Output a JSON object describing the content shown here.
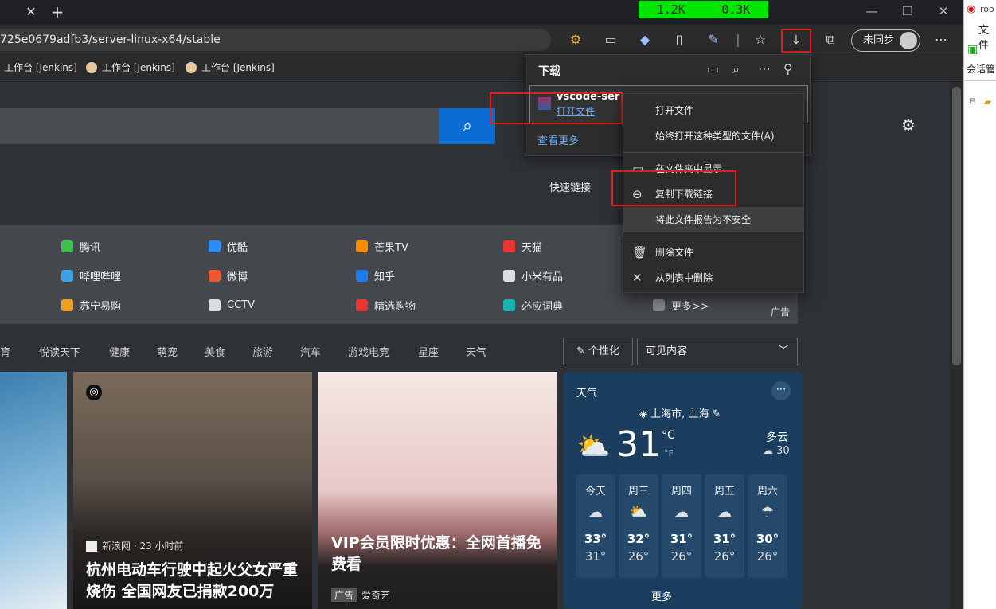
{
  "browser": {
    "tab_close": "✕",
    "tab_new": "+",
    "net_down": "1.2K",
    "net_up": "0.3K",
    "url": "725e0679adfb3/server-linux-x64/stable",
    "sync_label": "未同步"
  },
  "favorites": [
    {
      "label": "工作台 [Jenkins]"
    },
    {
      "label": "工作台 [Jenkins]"
    },
    {
      "label": "工作台 [Jenkins]"
    }
  ],
  "downloads": {
    "title": "下载",
    "file_name": "vscode-server-li",
    "open_file": "打开文件",
    "see_more": "查看更多"
  },
  "context_menu": {
    "items": [
      {
        "label": "打开文件"
      },
      {
        "label": "始终打开这种类型的文件(A)"
      },
      {
        "label": "在文件夹中显示"
      },
      {
        "label": "复制下载链接"
      },
      {
        "label": "将此文件报告为不安全"
      },
      {
        "label": "删除文件"
      },
      {
        "label": "从列表中删除"
      }
    ]
  },
  "newtab": {
    "quick_links": "快速链接",
    "links": [
      {
        "label": "腾讯",
        "color": "#3fbf4f"
      },
      {
        "label": "优酷",
        "color": "#2b8cff"
      },
      {
        "label": "芒果TV",
        "color": "#ff8a00"
      },
      {
        "label": "天猫",
        "color": "#e33"
      },
      {
        "label": "哔哩哔哩",
        "color": "#3aa0e8"
      },
      {
        "label": "微博",
        "color": "#e53"
      },
      {
        "label": "知乎",
        "color": "#1a7cf0"
      },
      {
        "label": "小米有品",
        "color": "#ddd"
      },
      {
        "label": "苏宁易购",
        "color": "#f0a020"
      },
      {
        "label": "CCTV",
        "color": "#ddd"
      },
      {
        "label": "精选购物",
        "color": "#e33"
      },
      {
        "label": "必应词典",
        "color": "#19b3b3"
      },
      {
        "label": "更多>>",
        "color": "#888"
      }
    ],
    "ad_label": "广告",
    "categories": [
      "体育",
      "悦读天下",
      "健康",
      "萌宠",
      "美食",
      "旅游",
      "汽车",
      "游戏电竞",
      "星座",
      "天气"
    ],
    "personalize": "个性化",
    "visible_content": "可见内容"
  },
  "cards": [
    {
      "source": "新浪网 · 23 小时前",
      "title": "杭州电动车行驶中起火父女严重烧伤 全国网友已捐款200万"
    },
    {
      "title": "VIP会员限时优惠：全网首播免费看",
      "ad": "广告",
      "source": "爱奇艺"
    }
  ],
  "weather": {
    "title": "天气",
    "location": "上海市, 上海",
    "temp": "31",
    "unit_c": "°C",
    "unit_f": "°F",
    "condition": "多云",
    "aqi": "30",
    "days": [
      {
        "day": "今天",
        "high": "33°",
        "low": "31°"
      },
      {
        "day": "周三",
        "high": "32°",
        "low": "26°"
      },
      {
        "day": "周四",
        "high": "31°",
        "low": "26°"
      },
      {
        "day": "周五",
        "high": "31°",
        "low": "26°"
      },
      {
        "day": "周六",
        "high": "30°",
        "low": "26°"
      }
    ],
    "more": "更多"
  },
  "side_app": {
    "title": "roo",
    "menu_file": "文件",
    "session": "会话管"
  }
}
